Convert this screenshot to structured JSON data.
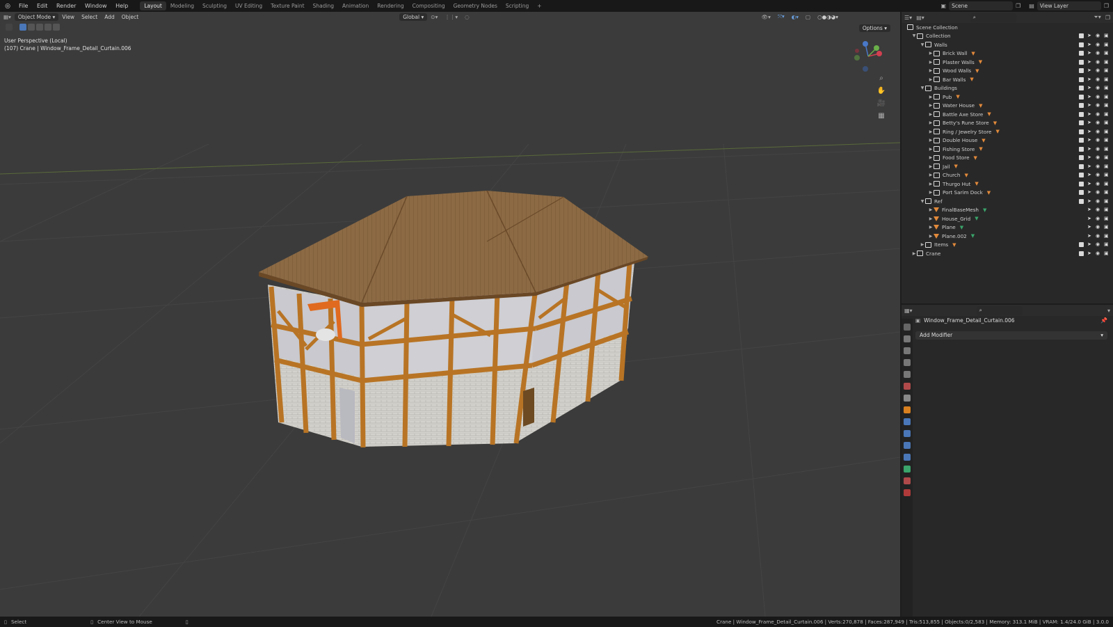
{
  "topbar": {
    "menus": [
      "File",
      "Edit",
      "Render",
      "Window",
      "Help"
    ],
    "workspaces": [
      "Layout",
      "Modeling",
      "Sculpting",
      "UV Editing",
      "Texture Paint",
      "Shading",
      "Animation",
      "Rendering",
      "Compositing",
      "Geometry Nodes",
      "Scripting"
    ],
    "active_workspace": "Layout",
    "scene": "Scene",
    "view_layer": "View Layer"
  },
  "viewport": {
    "mode": "Object Mode",
    "menus": [
      "View",
      "Select",
      "Add",
      "Object"
    ],
    "orientation": "Global",
    "options_label": "Options",
    "overlay_line1": "User Perspective (Local)",
    "overlay_line2": "(107) Crane | Window_Frame_Detail_Curtain.006"
  },
  "outliner": {
    "root": "Scene Collection",
    "rows": [
      {
        "label": "Collection",
        "depth": 0,
        "type": "collection",
        "expanded": true
      },
      {
        "label": "Walls",
        "depth": 1,
        "type": "collection",
        "expanded": true
      },
      {
        "label": "Brick Wall",
        "depth": 2,
        "type": "collection"
      },
      {
        "label": "Plaster Walls",
        "depth": 2,
        "type": "collection"
      },
      {
        "label": "Wood Walls",
        "depth": 2,
        "type": "collection"
      },
      {
        "label": "Bar Walls",
        "depth": 2,
        "type": "collection"
      },
      {
        "label": "Buildings",
        "depth": 1,
        "type": "collection",
        "expanded": true
      },
      {
        "label": "Pub",
        "depth": 2,
        "type": "collection"
      },
      {
        "label": "Water House",
        "depth": 2,
        "type": "collection"
      },
      {
        "label": "Battle Axe Store",
        "depth": 2,
        "type": "collection"
      },
      {
        "label": "Betty's Rune Store",
        "depth": 2,
        "type": "collection"
      },
      {
        "label": "Ring / Jewelry Store",
        "depth": 2,
        "type": "collection"
      },
      {
        "label": "Double House",
        "depth": 2,
        "type": "collection"
      },
      {
        "label": "Fishing Store",
        "depth": 2,
        "type": "collection"
      },
      {
        "label": "Food Store",
        "depth": 2,
        "type": "collection"
      },
      {
        "label": "Jail",
        "depth": 2,
        "type": "collection"
      },
      {
        "label": "Church",
        "depth": 2,
        "type": "collection"
      },
      {
        "label": "Thurgo Hut",
        "depth": 2,
        "type": "collection"
      },
      {
        "label": "Port Sarim Dock",
        "depth": 2,
        "type": "collection"
      },
      {
        "label": "Ref",
        "depth": 1,
        "type": "collection",
        "expanded": true
      },
      {
        "label": "FinalBaseMesh",
        "depth": 2,
        "type": "object"
      },
      {
        "label": "House_Grid",
        "depth": 2,
        "type": "object"
      },
      {
        "label": "Plane",
        "depth": 2,
        "type": "object"
      },
      {
        "label": "Plane.002",
        "depth": 2,
        "type": "object"
      },
      {
        "label": "Items",
        "depth": 1,
        "type": "collection"
      },
      {
        "label": "Crane",
        "depth": 0,
        "type": "collection"
      }
    ]
  },
  "properties": {
    "object_name": "Window_Frame_Detail_Curtain.006",
    "add_modifier": "Add Modifier"
  },
  "statusbar": {
    "select": "Select",
    "center_view": "Center View to Mouse",
    "stats": "Crane | Window_Frame_Detail_Curtain.006 | Verts:270,878 | Faces:287,949 | Tris:513,855 | Objects:0/2,583 | Memory: 313.1 MiB | VRAM: 1.4/24.0 GiB | 3.0.0"
  },
  "colors": {
    "accent_blue": "#4a77b8",
    "active_orange": "#e28a3b",
    "wood": "#b87424",
    "plaster": "#c8c8cc"
  }
}
